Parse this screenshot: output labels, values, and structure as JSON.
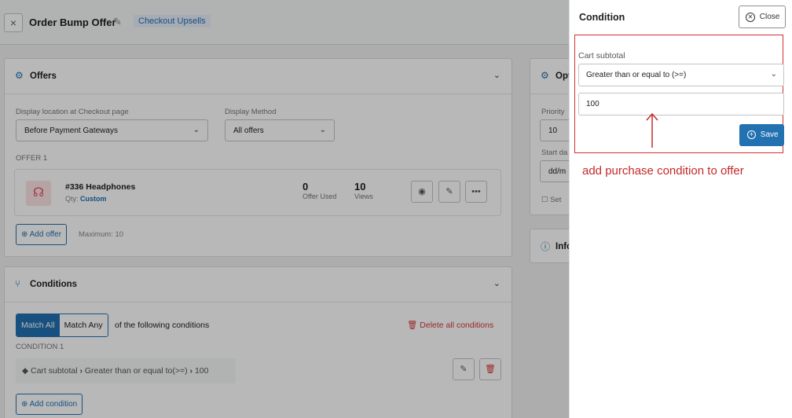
{
  "header": {
    "close_glyph": "×",
    "title": "Order Bump Offer",
    "tag": "Checkout Upsells"
  },
  "offers_card": {
    "title": "Offers",
    "display_location_label": "Display location at Checkout page",
    "display_location_value": "Before Payment Gateways",
    "display_method_label": "Display Method",
    "display_method_value": "All offers",
    "offer_section_label": "OFFER 1",
    "offer": {
      "name": "#336 Headphones",
      "qty_label": "Qty:",
      "qty_value": "Custom",
      "used_count": "0",
      "used_label": "Offer Used",
      "views_count": "10",
      "views_label": "Views",
      "more_glyph": "•••"
    },
    "add_offer_label": "Add offer",
    "maximum_text": "Maximum: 10"
  },
  "options_card": {
    "title": "Opti",
    "priority_label": "Priority",
    "priority_value": "10",
    "start_label": "Start da",
    "start_value": "dd/m",
    "set_label": "Set"
  },
  "info_card": {
    "title": "Info"
  },
  "conditions_card": {
    "title": "Conditions",
    "match_all": "Match All",
    "match_any": "Match Any",
    "following_text": "of the following conditions",
    "delete_all": "Delete all conditions",
    "condition_label": "CONDITION 1",
    "condition_field": "Cart subtotal",
    "condition_operator": "Greater than or equal to(>=)",
    "condition_value": "100",
    "add_condition": "Add condition"
  },
  "panel": {
    "title": "Condition",
    "close_label": "Close",
    "field_label": "Cart subtotal",
    "operator_value": "Greater than or equal to (>=)",
    "amount_value": "100",
    "save_label": "Save"
  },
  "annotation": {
    "text": "add purchase condition to offer"
  },
  "colors": {
    "accent": "#2271b1",
    "annotation": "#c62828",
    "danger": "#d63638"
  },
  "icons": {
    "edit": "pencil-icon",
    "offers": "gear-icon",
    "conditions": "branch-icon",
    "product": "headphones-icon",
    "view": "eye-icon",
    "edit_offer": "edit-icon",
    "more": "more-icon",
    "add": "plus-circle-icon",
    "trash": "trash-icon",
    "close": "close-circle-icon",
    "info": "info-icon"
  }
}
